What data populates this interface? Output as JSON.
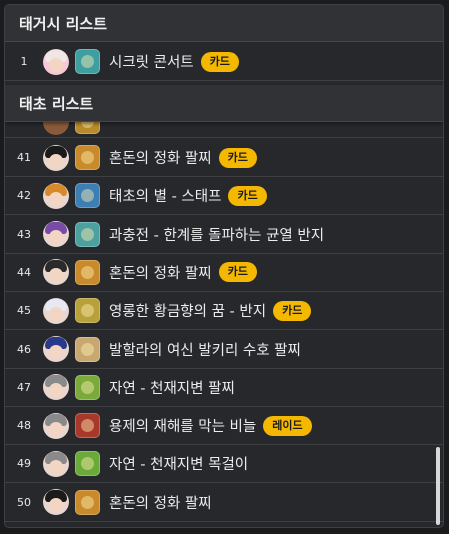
{
  "section1": {
    "title": "태거시 리스트",
    "rows": [
      {
        "num": "1",
        "name": "시크릿 콘서트",
        "badge": "카드",
        "hair": "#f1e6e6",
        "item": "#3f9fa0"
      }
    ]
  },
  "section2": {
    "title": "태초 리스트",
    "rows": [
      {
        "num": "41",
        "name": "혼돈의 정화 팔찌",
        "badge": "카드",
        "hair": "#1a1a1a",
        "item": "#c88a2a"
      },
      {
        "num": "42",
        "name": "태초의 별 - 스태프",
        "badge": "카드",
        "hair": "#d88a2a",
        "item": "#3d7fb3"
      },
      {
        "num": "43",
        "name": "과충전 - 한계를 돌파하는 균열 반지",
        "badge": "",
        "hair": "#7a4aa8",
        "item": "#4da0a0"
      },
      {
        "num": "44",
        "name": "혼돈의 정화 팔찌",
        "badge": "카드",
        "hair": "#2a2a2a",
        "item": "#c88a2a"
      },
      {
        "num": "45",
        "name": "영롱한 황금향의 꿈 - 반지",
        "badge": "카드",
        "hair": "#e8e8f2",
        "item": "#b8a03a"
      },
      {
        "num": "46",
        "name": "발할라의 여신 발키리 수호 팔찌",
        "badge": "",
        "hair": "#2a3a8a",
        "item": "#c8a870"
      },
      {
        "num": "47",
        "name": "자연 - 천재지변 팔찌",
        "badge": "",
        "hair": "#8a8a8a",
        "item": "#7aaa3a"
      },
      {
        "num": "48",
        "name": "용제의 재해를 막는 비늘",
        "badge": "레이드",
        "hair": "#8a8a8a",
        "item": "#a8382a"
      },
      {
        "num": "49",
        "name": "자연 - 천재지변 목걸이",
        "badge": "",
        "hair": "#8a8a8a",
        "item": "#6aaa3a"
      },
      {
        "num": "50",
        "name": "혼돈의 정화 팔찌",
        "badge": "",
        "hair": "#1a1a1a",
        "item": "#c88a2a"
      }
    ]
  },
  "colors": {
    "badge": "#f5b800",
    "background": "#26282b",
    "header": "#303235"
  }
}
